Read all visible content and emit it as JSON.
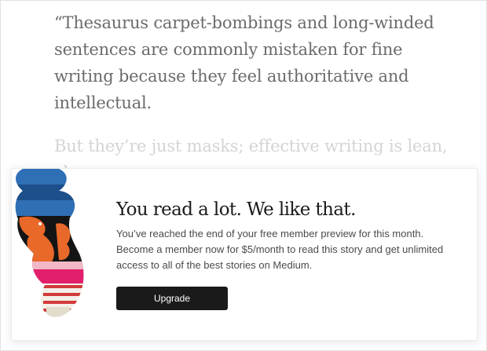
{
  "article": {
    "paragraph_1": "“Thesaurus carpet-bombings and long-winded sentences are commonly mistaken for fine writing because they feel authoritative and intellectual.",
    "paragraph_2": "But they’re just masks; effective writing is lean, clean…"
  },
  "paywall": {
    "headline": "You read a lot. We like that.",
    "body": "You’ve reached the end of your free member preview for this month. Become a member now for $5/month to read this story and get unlimited access to all of the best stories on Medium.",
    "button_label": "Upgrade",
    "illustration": "colorful-collage-illustration"
  },
  "colors": {
    "text_primary": "#1a1a1a",
    "text_faded": "#d4d4d4",
    "button_bg": "#1a1a1a"
  }
}
